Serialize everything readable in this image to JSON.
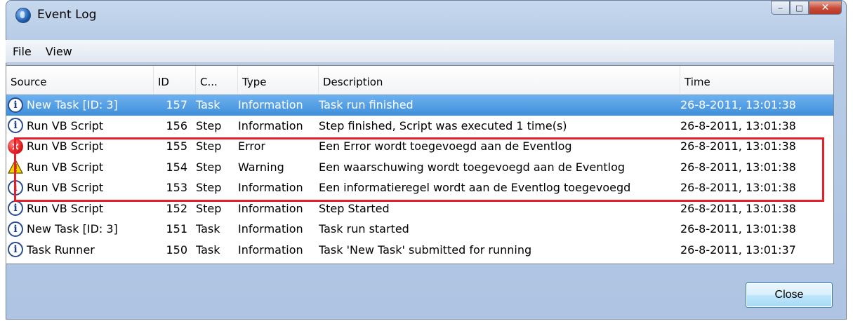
{
  "window": {
    "title": "Event Log"
  },
  "menu": [
    "File",
    "View"
  ],
  "columns": [
    "Source",
    "ID",
    "C...",
    "Type",
    "Description",
    "Time"
  ],
  "rows": [
    {
      "icon": "info-icon",
      "source": "New Task [ID: 3]",
      "id": "157",
      "category": "Task",
      "type": "Information",
      "description": "Task run finished",
      "time": "26-8-2011, 13:01:38",
      "selected": true
    },
    {
      "icon": "info-icon",
      "source": "Run VB Script",
      "id": "156",
      "category": "Step",
      "type": "Information",
      "description": "Step finished, Script was executed 1 time(s)",
      "time": "26-8-2011, 13:01:38",
      "selected": false
    },
    {
      "icon": "error-icon",
      "source": "Run VB Script",
      "id": "155",
      "category": "Step",
      "type": "Error",
      "description": "Een Error wordt toegevoegd aan de Eventlog",
      "time": "26-8-2011, 13:01:38",
      "selected": false
    },
    {
      "icon": "warning-icon",
      "source": "Run VB Script",
      "id": "154",
      "category": "Step",
      "type": "Warning",
      "description": "Een waarschuwing wordt toegevoegd aan de Eventlog",
      "time": "26-8-2011, 13:01:38",
      "selected": false
    },
    {
      "icon": "info-icon",
      "source": "Run VB Script",
      "id": "153",
      "category": "Step",
      "type": "Information",
      "description": "Een informatieregel wordt aan de Eventlog toegevoegd",
      "time": "26-8-2011, 13:01:38",
      "selected": false
    },
    {
      "icon": "info-icon",
      "source": "Run VB Script",
      "id": "152",
      "category": "Step",
      "type": "Information",
      "description": "Step Started",
      "time": "26-8-2011, 13:01:38",
      "selected": false
    },
    {
      "icon": "info-icon",
      "source": "New Task [ID: 3]",
      "id": "151",
      "category": "Task",
      "type": "Information",
      "description": "Task run started",
      "time": "26-8-2011, 13:01:38",
      "selected": false
    },
    {
      "icon": "info-icon",
      "source": "Task Runner",
      "id": "150",
      "category": "Task",
      "type": "Information",
      "description": "Task 'New Task' submitted for running",
      "time": "26-8-2011, 13:01:37",
      "selected": false
    }
  ],
  "buttons": {
    "close": "Close"
  },
  "colors": {
    "selection": "#3f8fdc",
    "highlight": "#e3202b"
  }
}
